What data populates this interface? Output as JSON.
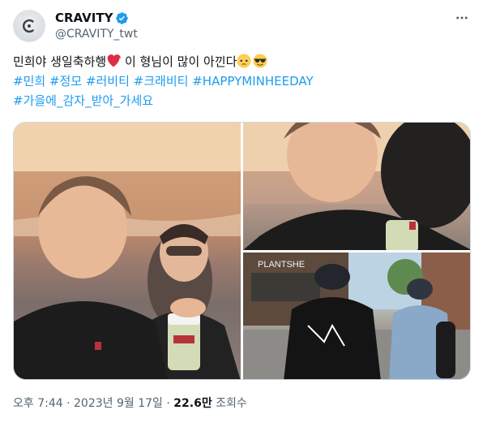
{
  "author": {
    "display_name": "CRAVITY",
    "handle": "@CRAVITY_twt",
    "avatar_text": "CRAVITY"
  },
  "tweet": {
    "line1_text": "민희야 생일축하행",
    "line1_after_heart": " 이 형님이 많이 아낀다",
    "hashtags_line2": [
      "#민희",
      "#정모",
      "#러비티",
      "#크래비티",
      "#HAPPYMINHEEDAY"
    ],
    "hashtags_line3": [
      "#가을에_감자_받아_가세요"
    ],
    "emojis": [
      "red-heart",
      "pleading-face",
      "smiling-face-with-sunglasses"
    ]
  },
  "media": {
    "photos": [
      {
        "name": "selfie-sunset-beach",
        "description_colors": [
          "#e9c7a0",
          "#7b6d6a"
        ]
      },
      {
        "name": "selfie-closeup",
        "description_colors": [
          "#eac9a8",
          "#8a7d76"
        ]
      },
      {
        "name": "street-back-view",
        "description_colors": [
          "#b8cfe0",
          "#6d6d6d"
        ]
      }
    ],
    "storefront_sign": "PLANTSHE"
  },
  "meta": {
    "time": "오후 7:44",
    "date": "2023년 9월 17일",
    "separator": "·",
    "views_count": "22.6만",
    "views_label": "조회수"
  },
  "colors": {
    "link": "#1d9bf0",
    "secondary_text": "#536471",
    "verified_badge": "#1d9bf0"
  }
}
